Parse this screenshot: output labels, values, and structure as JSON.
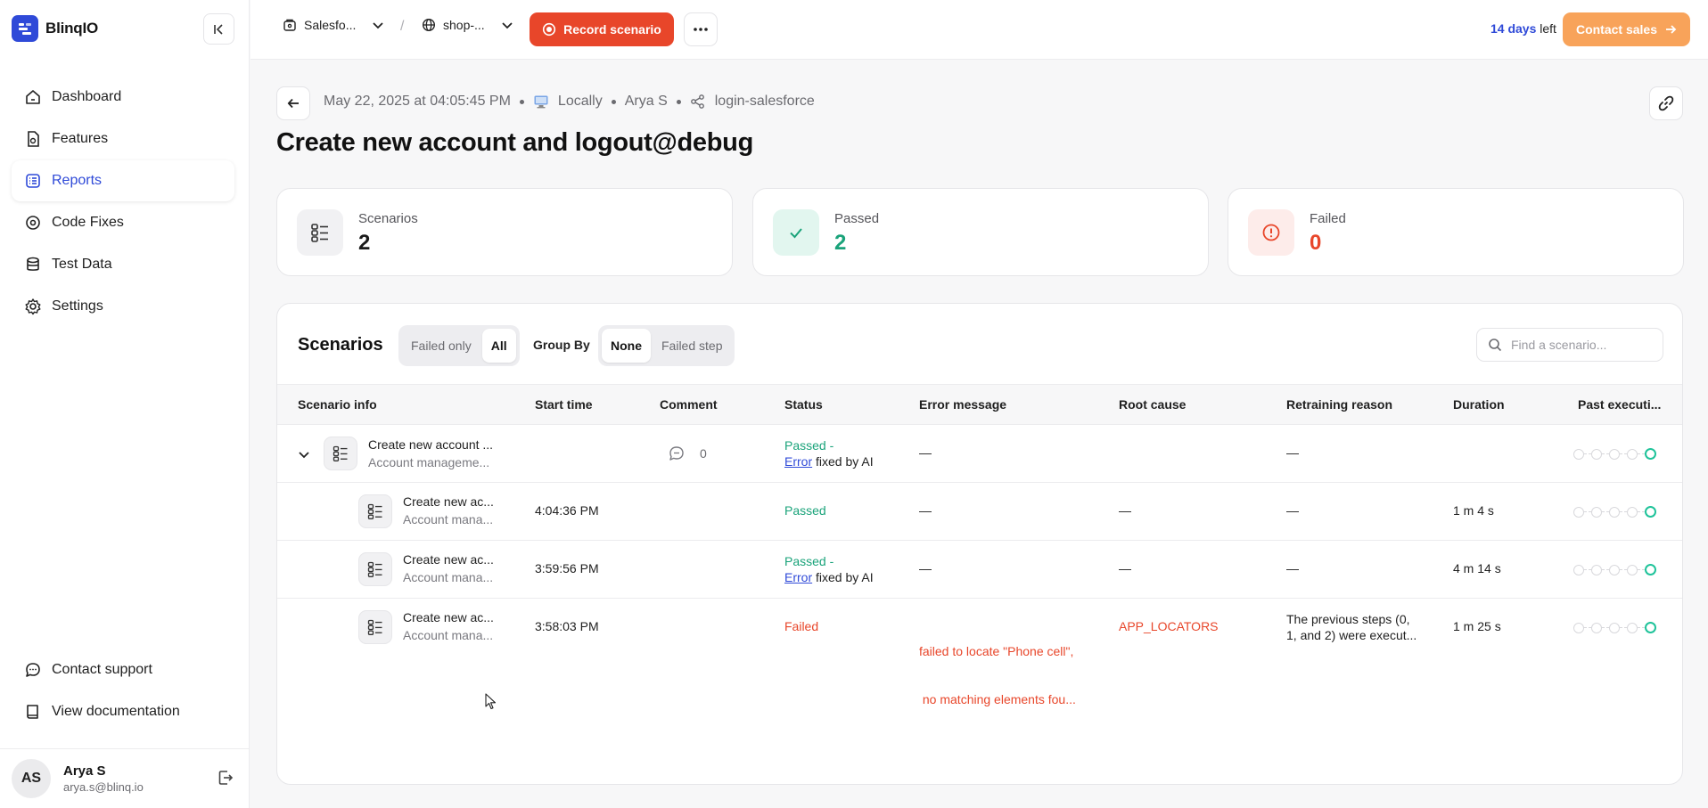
{
  "brand": {
    "name": "BlinqIO"
  },
  "sidebar": {
    "items": [
      {
        "label": "Dashboard",
        "icon": "home-icon"
      },
      {
        "label": "Features",
        "icon": "feature-icon"
      },
      {
        "label": "Reports",
        "icon": "report-icon",
        "active": true
      },
      {
        "label": "Code Fixes",
        "icon": "code-fix-icon"
      },
      {
        "label": "Test Data",
        "icon": "database-icon"
      },
      {
        "label": "Settings",
        "icon": "gear-icon"
      }
    ],
    "bottom": [
      {
        "label": "Contact support",
        "icon": "chat-icon"
      },
      {
        "label": "View documentation",
        "icon": "book-icon"
      }
    ],
    "user": {
      "initials": "AS",
      "name": "Arya S",
      "email": "arya.s@blinq.io"
    }
  },
  "topbar": {
    "project": "Salesfo...",
    "environment": "shop-...",
    "record_label": "Record scenario",
    "trial_days": "14 days",
    "trial_suffix": "left",
    "contact_sales": "Contact sales"
  },
  "header": {
    "timestamp": "May 22, 2025 at 04:05:45 PM",
    "location": "Locally",
    "author": "Arya S",
    "flow": "login-salesforce",
    "title": "Create new account and logout@debug"
  },
  "stats": {
    "scenarios": {
      "label": "Scenarios",
      "value": "2"
    },
    "passed": {
      "label": "Passed",
      "value": "2"
    },
    "failed": {
      "label": "Failed",
      "value": "0"
    }
  },
  "scenarios": {
    "title": "Scenarios",
    "filter": {
      "failed_only": "Failed only",
      "all": "All"
    },
    "group_by": {
      "label": "Group By",
      "none": "None",
      "failed_step": "Failed step"
    },
    "search_placeholder": "Find a scenario...",
    "columns": [
      "Scenario info",
      "Start time",
      "Comment",
      "Status",
      "Error message",
      "Root cause",
      "Retraining reason",
      "Duration",
      "Past executi..."
    ],
    "rows": [
      {
        "name": "Create new account ...",
        "feature": "Account manageme...",
        "start": "",
        "comment_count": "0",
        "status": "Passed",
        "status_suffix": " -",
        "error_link": "Error",
        "fixed": " fixed by AI",
        "error": "—",
        "root_cause": "",
        "retraining": "—",
        "duration": ""
      },
      {
        "name": "Create new ac...",
        "feature": "Account mana...",
        "start": "4:04:36 PM",
        "status": "Passed",
        "error": "—",
        "root_cause": "—",
        "retraining": "—",
        "duration": "1 m 4 s"
      },
      {
        "name": "Create new ac...",
        "feature": "Account mana...",
        "start": "3:59:56 PM",
        "status": "Passed",
        "status_suffix": " -",
        "error_link": "Error",
        "fixed": " fixed by AI",
        "error": "—",
        "root_cause": "—",
        "retraining": "—",
        "duration": "4 m 14 s"
      },
      {
        "name": "Create new ac...",
        "feature": "Account mana...",
        "start": "3:58:03 PM",
        "status": "Failed",
        "error_line1": "failed to locate \"Phone cell\",",
        "error_line2": " no matching elements fou...",
        "root_cause": "APP_LOCATORS",
        "retraining_line1": "The previous steps (0,",
        "retraining_line2": "1, and 2) were execut...",
        "duration": "1 m 25 s"
      }
    ]
  },
  "colors": {
    "accent": "#2f4ad8",
    "record": "#e8462a",
    "sales": "#f8a35a",
    "passed": "#1aa37a",
    "failed": "#e8462a"
  }
}
